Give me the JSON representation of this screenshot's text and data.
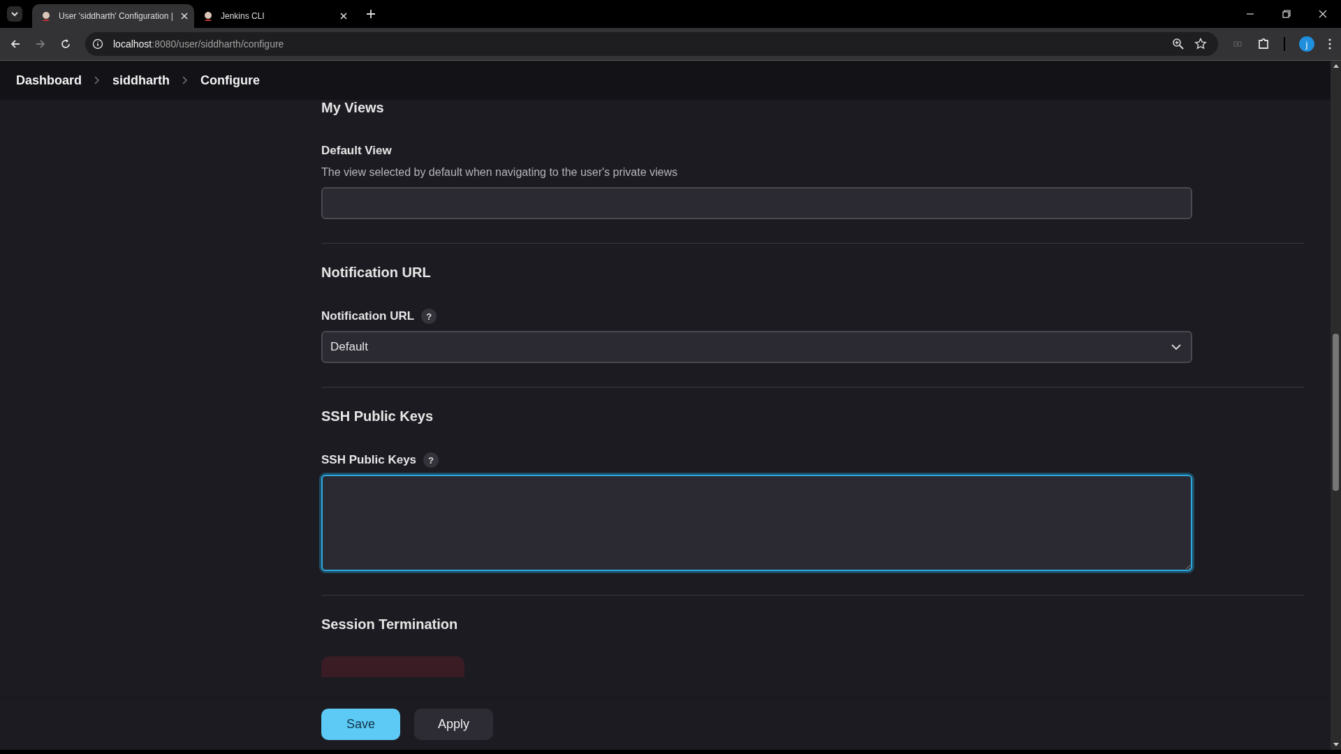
{
  "browser": {
    "tabs": [
      {
        "title": "User 'siddharth' Configuration |",
        "selected": true
      },
      {
        "title": "Jenkins CLI",
        "selected": false
      }
    ],
    "address": {
      "host": "localhost",
      "path": ":8080/user/siddharth/configure"
    },
    "profile_initial": "j"
  },
  "breadcrumbs": [
    "Dashboard",
    "siddharth",
    "Configure"
  ],
  "sections": [
    {
      "title": "My Views",
      "fields": [
        {
          "kind": "text",
          "label": "Default View",
          "description": "The view selected by default when navigating to the user's private views",
          "focused": false
        }
      ]
    },
    {
      "title": "Notification URL",
      "fields": [
        {
          "kind": "select",
          "label": "Notification URL",
          "help": "?",
          "value": "Default",
          "focused": false
        }
      ]
    },
    {
      "title": "SSH Public Keys",
      "fields": [
        {
          "kind": "textarea",
          "label": "SSH Public Keys",
          "help": "?",
          "focused": true
        }
      ]
    },
    {
      "title": "Session Termination",
      "fields": [
        {
          "kind": "danger-button"
        }
      ]
    }
  ],
  "buttons": [
    {
      "label": "Save",
      "kind": "primary"
    },
    {
      "label": "Apply",
      "kind": "secondary"
    }
  ]
}
